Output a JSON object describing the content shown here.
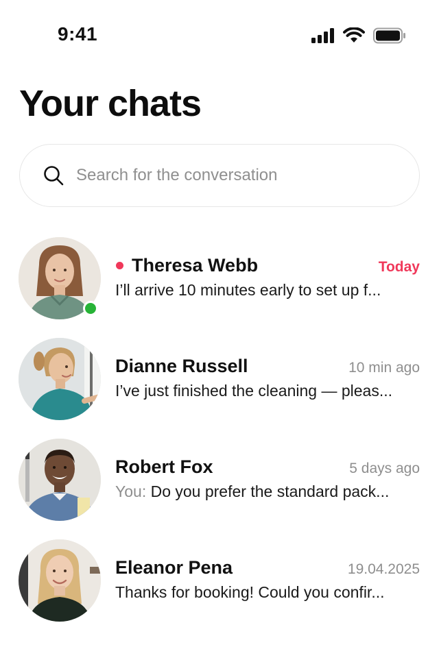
{
  "status_bar": {
    "time": "9:41"
  },
  "header": {
    "title": "Your chats"
  },
  "search": {
    "placeholder": "Search for the conversation"
  },
  "chats": [
    {
      "name": "Theresa Webb",
      "time": "Today",
      "preview": "I’ll arrive 10 minutes early to set up f...",
      "prefix": "",
      "unread": true,
      "online": true
    },
    {
      "name": "Dianne Russell",
      "time": "10 min ago",
      "preview": "I’ve just finished the cleaning — pleas...",
      "prefix": "",
      "unread": false,
      "online": false
    },
    {
      "name": "Robert Fox",
      "time": "5 days ago",
      "preview": "Do you prefer the standard pack...",
      "prefix": "You:",
      "unread": false,
      "online": false
    },
    {
      "name": "Eleanor Pena",
      "time": "19.04.2025",
      "preview": "Thanks for booking! Could you confir...",
      "prefix": "",
      "unread": false,
      "online": false
    }
  ],
  "colors": {
    "accent": "#f0385a",
    "online": "#27b337",
    "muted_text": "#8e8e8e"
  },
  "icons": [
    "signal-icon",
    "wifi-icon",
    "battery-icon",
    "search-icon"
  ]
}
